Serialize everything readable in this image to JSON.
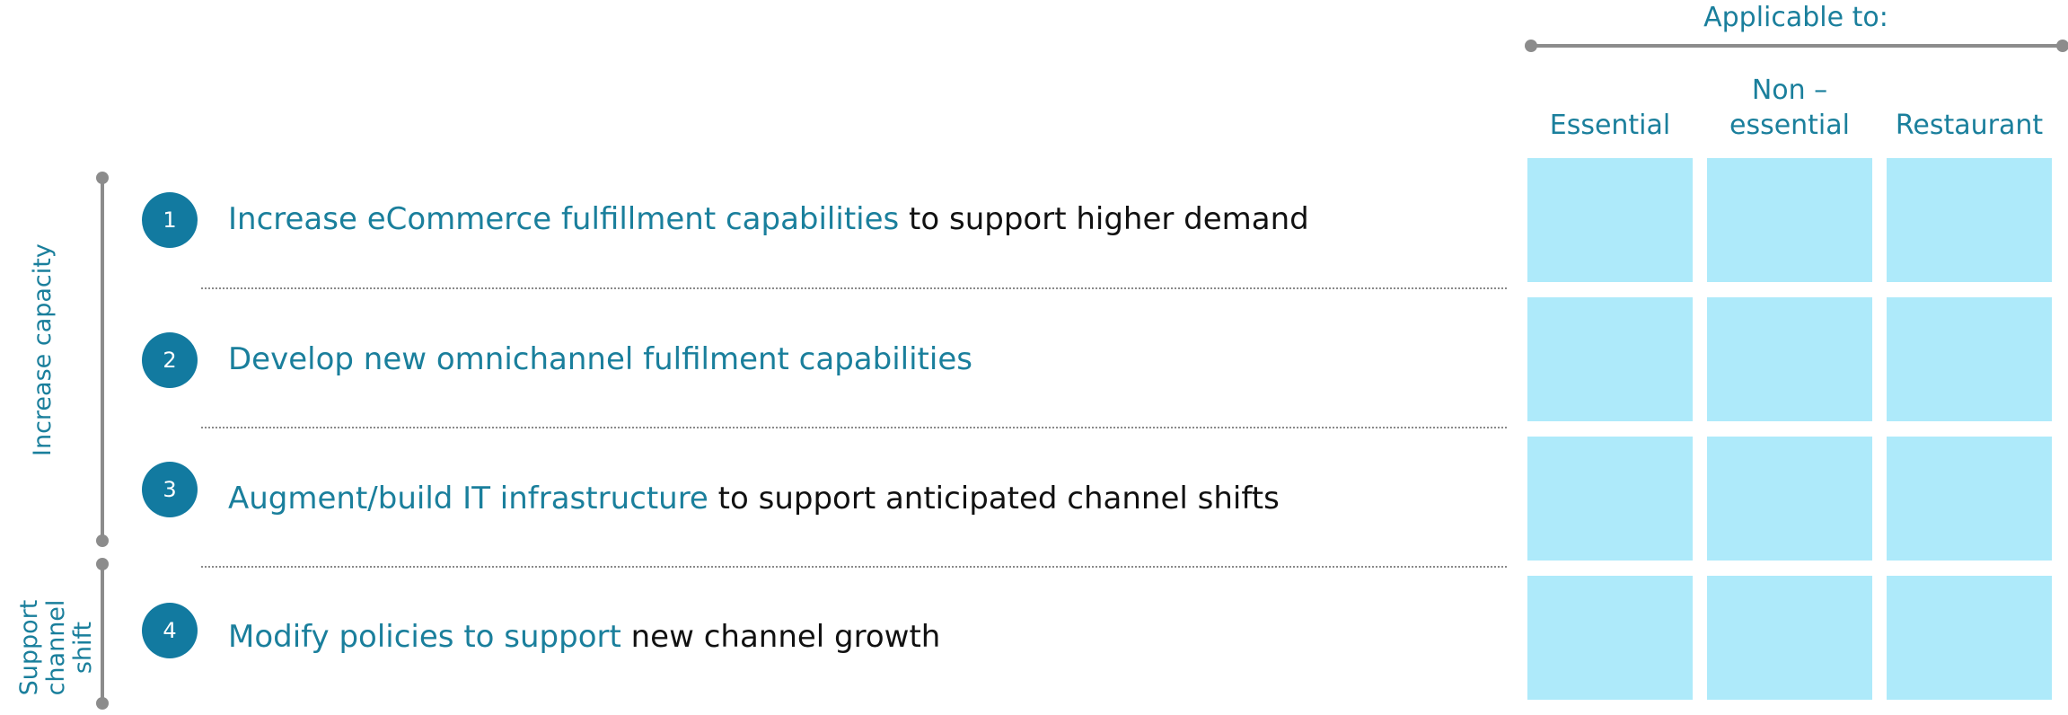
{
  "header": {
    "applicable_label": "Applicable to:",
    "columns": [
      "Essential",
      "Non –\nessential",
      "Restaurant"
    ]
  },
  "groups": [
    {
      "label": "Increase capacity"
    },
    {
      "label": "Support\nchannel shift"
    }
  ],
  "rows": [
    {
      "number": "1",
      "highlight": "Increase eCommerce fulfillment capabilities",
      "rest": " to support higher demand"
    },
    {
      "number": "2",
      "highlight": "Develop new omnichannel fulfilment capabilities",
      "rest": ""
    },
    {
      "number": "3",
      "highlight": "Augment/build IT infrastructure",
      "rest": " to support anticipated channel shifts"
    },
    {
      "number": "4",
      "highlight": "Modify policies to support",
      "rest": " new channel growth"
    }
  ],
  "colors": {
    "accent_text": "#1a7f9c",
    "badge": "#127aa0",
    "cell_fill": "#aeeafa",
    "bracket": "#8c8c8c"
  }
}
